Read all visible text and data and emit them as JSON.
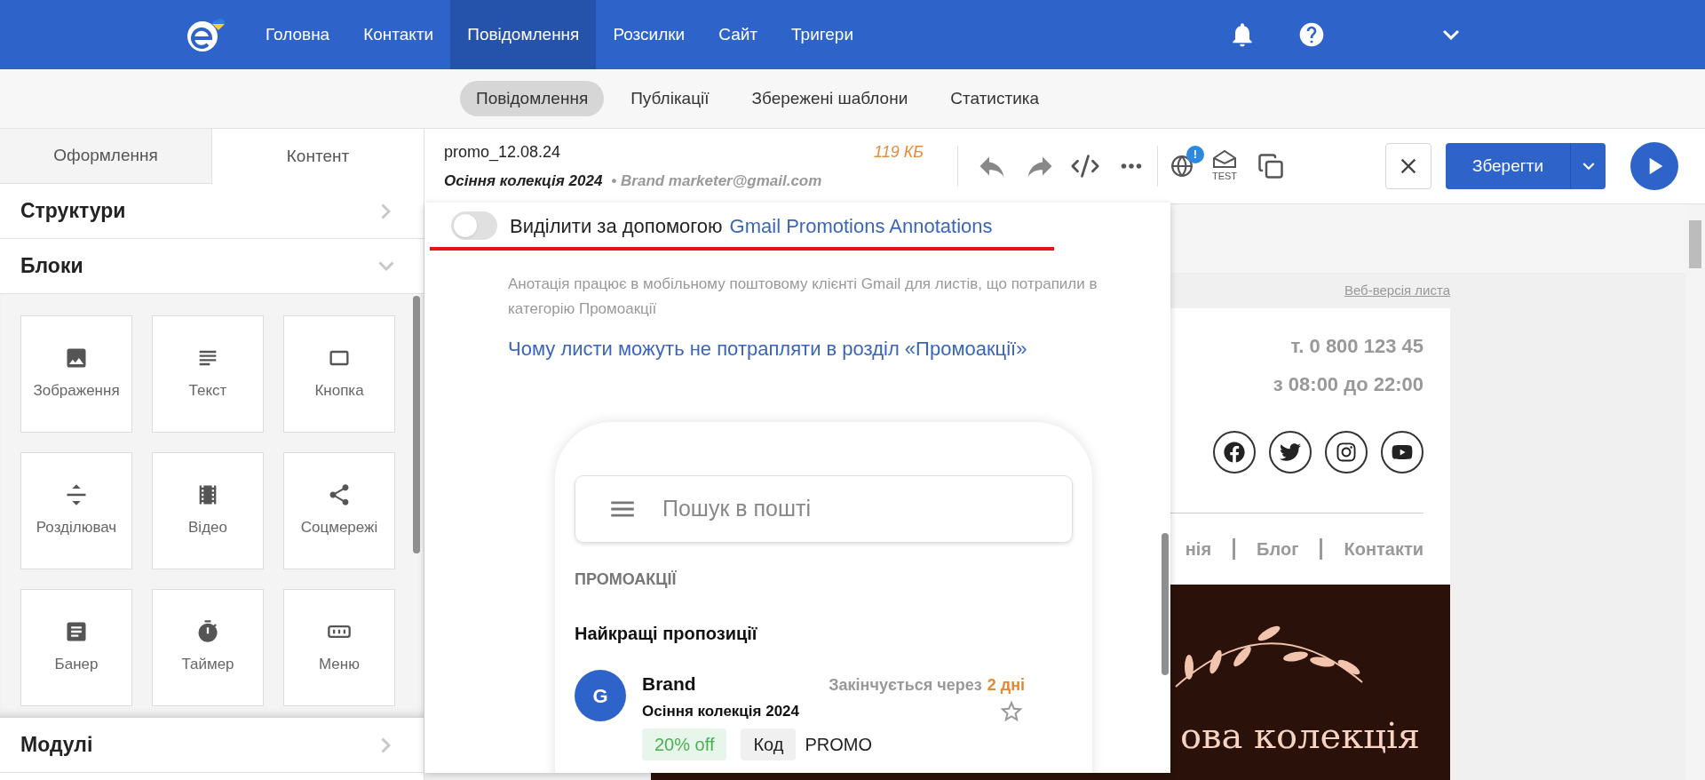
{
  "top_nav": {
    "items": [
      {
        "label": "Головна",
        "selected": false
      },
      {
        "label": "Контакти",
        "selected": false
      },
      {
        "label": "Повідомлення",
        "selected": true
      },
      {
        "label": "Розсилки",
        "selected": false
      },
      {
        "label": "Сайт",
        "selected": false
      },
      {
        "label": "Тригери",
        "selected": false
      }
    ]
  },
  "sub_nav": {
    "items": [
      {
        "label": "Повідомлення",
        "selected": true
      },
      {
        "label": "Публікації",
        "selected": false
      },
      {
        "label": "Збережені шаблони",
        "selected": false
      },
      {
        "label": "Статистика",
        "selected": false
      }
    ]
  },
  "sidebar": {
    "tabs": [
      {
        "label": "Оформлення",
        "selected": false
      },
      {
        "label": "Контент",
        "selected": true
      }
    ],
    "sections": [
      {
        "title": "Структури",
        "expanded": false
      },
      {
        "title": "Блоки",
        "expanded": true,
        "blocks": [
          {
            "label": "Зображення",
            "kind": "image"
          },
          {
            "label": "Текст",
            "kind": "text"
          },
          {
            "label": "Кнопка",
            "kind": "button"
          },
          {
            "label": "Розділювач",
            "kind": "divider"
          },
          {
            "label": "Відео",
            "kind": "video"
          },
          {
            "label": "Соцмережі",
            "kind": "social"
          },
          {
            "label": "Банер",
            "kind": "banner"
          },
          {
            "label": "Таймер",
            "kind": "timer"
          },
          {
            "label": "Меню",
            "kind": "menu"
          }
        ]
      },
      {
        "title": "Модулі",
        "expanded": false
      }
    ]
  },
  "message": {
    "file_name": "promo_12.08.24",
    "subject": "Осіння колекція 2024",
    "sender": "• Brand marketer@gmail.com",
    "size": "119 КБ"
  },
  "toolbar": {
    "badge": "!",
    "test_label": "TEST",
    "save_label": "Зберегти"
  },
  "annotation_popup": {
    "toggle": {
      "on": false
    },
    "label": "Виділити за допомогою",
    "link": "Gmail Promotions Annotations",
    "description": "Анотація працює в мобільному поштовому клієнті Gmail для листів, що потрапили в категорію Промоакції",
    "help_link": "Чому листи можуть не потрапляти в розділ «Промоакції»",
    "phone": {
      "search_placeholder": "Пошук в пошті",
      "category": "ПРОМОАКЦІЇ",
      "section_title": "Найкращі пропозиції",
      "avatar": "G",
      "brand": "Brand",
      "expires_prefix": "Закінчується через",
      "expires_value": "2 дні",
      "subject": "Осіння колекція 2024",
      "starred": false,
      "discount": "20% off",
      "code_label": "Код",
      "code": "PROMO"
    }
  },
  "email_preview": {
    "web_version": "Веб-версія листа",
    "phone": "т. 0 800 123 45",
    "hours": "з 08:00 до 22:00",
    "nav": [
      "нія",
      "Блог",
      "Контакти"
    ],
    "banner_title": "ова колекція"
  }
}
